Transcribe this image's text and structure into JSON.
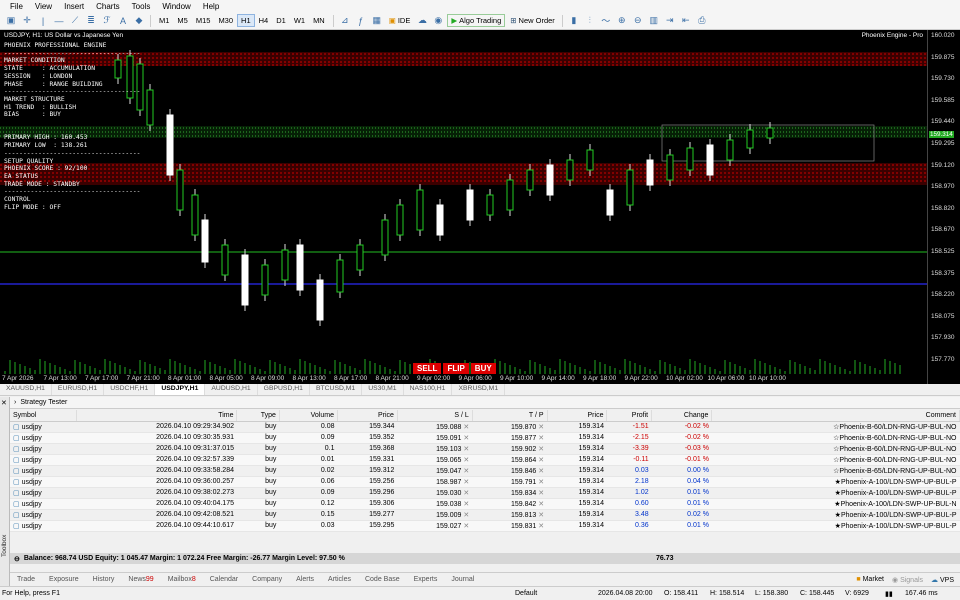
{
  "menu": [
    "File",
    "View",
    "Insert",
    "Charts",
    "Tools",
    "Window",
    "Help"
  ],
  "timeframes": [
    "M1",
    "M5",
    "M15",
    "M30",
    "H1",
    "H4",
    "D1",
    "W1",
    "MN"
  ],
  "active_timeframe": "H1",
  "toolbar": {
    "ide": "IDE",
    "algo": "Algo Trading",
    "new_order": "New Order"
  },
  "chart": {
    "title": "USDJPY, H1:  US Dollar vs Japanese Yen",
    "engine_label": "Phoenix Engine - Pro",
    "panel_text": "PHOENIX PROFESSIONAL ENGINE\n------------------------------------\nMARKET CONDITION\nSTATE     : ACCUMULATION\nSESSION   : LONDON\nPHASE     : RANGE BUILDING\n------------------------------------\nMARKET STRUCTURE\nH1 TREND  : BULLISH\nBIAS      : BUY\n\n\nPRIMARY HIGH : 160.453\nPRIMARY LOW  : 138.261\n------------------------------------\nSETUP QUALITY\nPHOENIX SCORE : 92/100\nEA STATUS\nTRADE MODE : STANDBY\n------------------------------------\nCONTROL\nFLIP MODE : OFF",
    "buttons": {
      "sell": "SELL",
      "flip": "FLIP",
      "buy": "BUY"
    },
    "price_labels": [
      "160.020",
      "159.875",
      "159.730",
      "159.585",
      "159.440",
      "159.295",
      "159.120",
      "158.970",
      "158.820",
      "158.670",
      "158.525",
      "158.375",
      "158.220",
      "158.075",
      "157.930",
      "157.770"
    ],
    "time_labels": [
      "7 Apr 2026",
      "7 Apr 13:00",
      "7 Apr 17:00",
      "7 Apr 21:00",
      "8 Apr 01:00",
      "8 Apr 05:00",
      "8 Apr 09:00",
      "8 Apr 13:00",
      "8 Apr 17:00",
      "8 Apr 21:00",
      "9 Apr 02:00",
      "9 Apr 06:00",
      "9 Apr 10:00",
      "9 Apr 14:00",
      "9 Apr 18:00",
      "9 Apr 22:00",
      "10 Apr 02:00",
      "10 Apr 06:00",
      "10 Apr 10:00"
    ],
    "bid_price": "159.314"
  },
  "symbol_tabs": [
    "XAUUSD,H1",
    "EURUSD,H1",
    "USDCHF,H1",
    "USDJPY,H1",
    "AUDUSD,H1",
    "GBPUSD,H1",
    "BTCUSD,M1",
    "US30,M1",
    "NAS100,H1",
    "XBRUSD,M1"
  ],
  "active_symbol_tab": "USDJPY,H1",
  "strategy_tester": "Strategy Tester",
  "columns": [
    "Symbol",
    "Time",
    "Type",
    "Volume",
    "Price",
    "S / L",
    "T / P",
    "Price",
    "Profit",
    "Change",
    "Comment"
  ],
  "rows": [
    [
      "usdjpy",
      "2026.04.10 09:29:34.902",
      "buy",
      "0.08",
      "159.344",
      "159.088",
      "159.870",
      "159.314",
      "-1.51",
      "-0.02 %",
      "Phoenix-B-60/LDN-RNG-UP-BUL-NO"
    ],
    [
      "usdjpy",
      "2026.04.10 09:30:35.931",
      "buy",
      "0.09",
      "159.352",
      "159.091",
      "159.877",
      "159.314",
      "-2.15",
      "-0.02 %",
      "Phoenix-B-60/LDN-RNG-UP-BUL-NO"
    ],
    [
      "usdjpy",
      "2026.04.10 09:31:37.015",
      "buy",
      "0.1",
      "159.368",
      "159.103",
      "159.902",
      "159.314",
      "-3.39",
      "-0.03 %",
      "Phoenix-B-60/LDN-RNG-UP-BUL-NO"
    ],
    [
      "usdjpy",
      "2026.04.10 09:32:57.339",
      "buy",
      "0.01",
      "159.331",
      "159.065",
      "159.864",
      "159.314",
      "-0.11",
      "-0.01 %",
      "Phoenix-B-60/LDN-RNG-UP-BUL-NO"
    ],
    [
      "usdjpy",
      "2026.04.10 09:33:58.284",
      "buy",
      "0.02",
      "159.312",
      "159.047",
      "159.846",
      "159.314",
      "0.03",
      "0.00 %",
      "Phoenix-B-65/LDN-RNG-UP-BUL-NO"
    ],
    [
      "usdjpy",
      "2026.04.10 09:36:00.257",
      "buy",
      "0.06",
      "159.256",
      "158.987",
      "159.791",
      "159.314",
      "2.18",
      "0.04 %",
      "Phoenix-A-100/LDN-SWP-UP-BUL-P"
    ],
    [
      "usdjpy",
      "2026.04.10 09:38:02.273",
      "buy",
      "0.09",
      "159.296",
      "159.030",
      "159.834",
      "159.314",
      "1.02",
      "0.01 %",
      "Phoenix-A-100/LDN-SWP-UP-BUL-P"
    ],
    [
      "usdjpy",
      "2026.04.10 09:40:04.175",
      "buy",
      "0.12",
      "159.306",
      "159.038",
      "159.842",
      "159.314",
      "0.60",
      "0.01 %",
      "Phoenix-A-100/LDN-SWP-UP-BUL-N"
    ],
    [
      "usdjpy",
      "2026.04.10 09:42:08.521",
      "buy",
      "0.15",
      "159.277",
      "159.009",
      "159.813",
      "159.314",
      "3.48",
      "0.02 %",
      "Phoenix-A-100/LDN-SWP-UP-BUL-P"
    ],
    [
      "usdjpy",
      "2026.04.10 09:44:10.617",
      "buy",
      "0.03",
      "159.295",
      "159.027",
      "159.831",
      "159.314",
      "0.36",
      "0.01 %",
      "Phoenix-A-100/LDN-SWP-UP-BUL-P"
    ]
  ],
  "balance_line": "Balance: 968.74 USD  Equity: 1 045.47  Margin: 1 072.24  Free Margin: -26.77  Margin Level: 97.50 %",
  "balance_profit": "76.73",
  "bottom_tabs": [
    "Trade",
    "Exposure",
    "History",
    "News",
    "Mailbox",
    "Calendar",
    "Company",
    "Alerts",
    "Articles",
    "Code Base",
    "Experts",
    "Journal"
  ],
  "news_badge": "99",
  "mailbox_badge": "8",
  "market_label": "Market",
  "signals_label": "Signals",
  "vps_label": "VPS",
  "toolbox_label": "Toolbox",
  "status": {
    "help": "For Help, press F1",
    "profile": "Default",
    "datetime": "2026.04.08 20:00",
    "o": "O: 158.411",
    "h": "H: 158.514",
    "l": "L: 158.380",
    "c": "C: 158.445",
    "v": "V: 6929",
    "ping": "167.46 ms"
  }
}
